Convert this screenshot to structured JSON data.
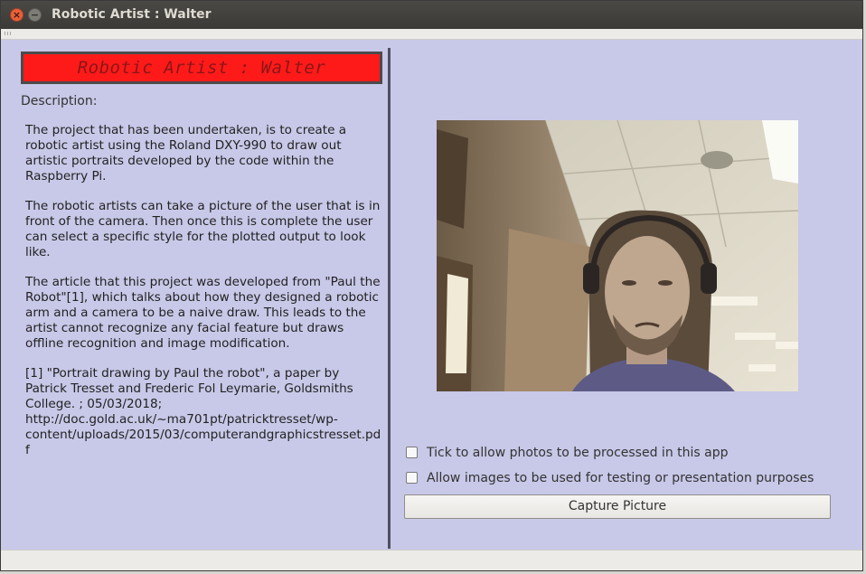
{
  "window": {
    "title": "Robotic Artist : Walter",
    "close_glyph": "×",
    "minimize_glyph": "−"
  },
  "left": {
    "header": "Robotic Artist : Walter",
    "description_label": "Description:",
    "paragraphs": [
      "The project that has been undertaken, is to create a robotic artist using the Roland DXY-990 to draw out artistic portraits developed by the code within the Raspberry Pi.",
      "The robotic artists can take a picture of the user that is in front of the camera. Then once this is complete the user can select a specific style for the plotted output to look like.",
      "The article that this project was developed from \"Paul the Robot\"[1], which talks about how they designed a robotic arm and a camera to be a naive draw. This leads to the artist cannot recognize any facial feature but draws offline recognition and image modification.",
      "[1] \"Portrait drawing by Paul the robot\", a paper by Patrick Tresset and Frederic Fol Leymarie, Goldsmiths College. ; 05/03/2018;\n    http://doc.gold.ac.uk/~ma701pt/patricktresset/wp-content/uploads/2015/03/computerandgraphicstresset.pdf"
    ]
  },
  "right": {
    "consent_process_label": "Tick to allow photos to be processed in this app",
    "consent_testing_label": "Allow images to be used for testing or presentation purposes",
    "capture_button": "Capture Picture"
  },
  "colors": {
    "window_bg": "#c8c8e8",
    "header_bg": "#ff1a1a",
    "header_text": "#8a1616"
  }
}
